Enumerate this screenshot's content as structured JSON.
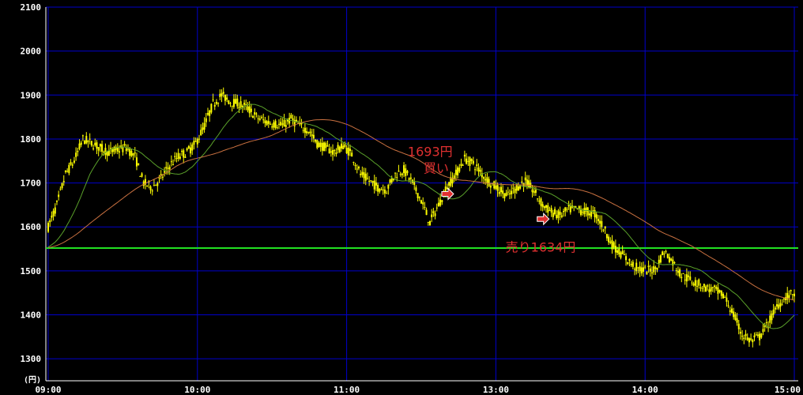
{
  "chart_data": {
    "type": "candlestick",
    "y_unit_label": "(円)",
    "ylim": [
      1250,
      2100
    ],
    "y_ticks": [
      "2100",
      "2000",
      "1900",
      "1800",
      "1700",
      "1600",
      "1500",
      "1400",
      "1300"
    ],
    "y_tick_values": [
      2100,
      2000,
      1900,
      1800,
      1700,
      1600,
      1500,
      1400,
      1300
    ],
    "x_ticks": [
      "09:00",
      "10:00",
      "11:00",
      "13:00",
      "14:00",
      "15:00"
    ],
    "reference_line": {
      "value": 1552,
      "color": "#22e022"
    },
    "colors": {
      "candle": "#ffff00",
      "grid": "#0000cc",
      "ma_short": "#5aa02a",
      "ma_long": "#c87040",
      "annotation": "#e03030"
    },
    "price_path": [
      [
        0,
        1600
      ],
      [
        1,
        1650
      ],
      [
        2,
        1720
      ],
      [
        3,
        1750
      ],
      [
        4,
        1800
      ],
      [
        5,
        1790
      ],
      [
        6,
        1780
      ],
      [
        7,
        1770
      ],
      [
        8,
        1775
      ],
      [
        9,
        1780
      ],
      [
        10,
        1760
      ],
      [
        11,
        1700
      ],
      [
        12,
        1690
      ],
      [
        13,
        1710
      ],
      [
        14,
        1740
      ],
      [
        15,
        1760
      ],
      [
        16,
        1770
      ],
      [
        17,
        1790
      ],
      [
        18,
        1830
      ],
      [
        19,
        1880
      ],
      [
        20,
        1900
      ],
      [
        21,
        1885
      ],
      [
        22,
        1880
      ],
      [
        23,
        1870
      ],
      [
        24,
        1850
      ],
      [
        25,
        1840
      ],
      [
        26,
        1835
      ],
      [
        27,
        1830
      ],
      [
        28,
        1845
      ],
      [
        29,
        1830
      ],
      [
        30,
        1820
      ],
      [
        31,
        1790
      ],
      [
        32,
        1780
      ],
      [
        33,
        1770
      ],
      [
        34,
        1785
      ],
      [
        35,
        1765
      ],
      [
        36,
        1720
      ],
      [
        37,
        1705
      ],
      [
        38,
        1690
      ],
      [
        39,
        1685
      ],
      [
        40,
        1720
      ],
      [
        41,
        1730
      ],
      [
        42,
        1700
      ],
      [
        43,
        1660
      ],
      [
        44,
        1610
      ],
      [
        45,
        1650
      ],
      [
        46,
        1693
      ],
      [
        47,
        1720
      ],
      [
        48,
        1755
      ],
      [
        49,
        1745
      ],
      [
        50,
        1720
      ],
      [
        51,
        1700
      ],
      [
        52,
        1685
      ],
      [
        53,
        1670
      ],
      [
        54,
        1690
      ],
      [
        55,
        1705
      ],
      [
        56,
        1680
      ],
      [
        57,
        1650
      ],
      [
        58,
        1634
      ],
      [
        59,
        1625
      ],
      [
        60,
        1640
      ],
      [
        61,
        1640
      ],
      [
        62,
        1635
      ],
      [
        63,
        1630
      ],
      [
        64,
        1600
      ],
      [
        65,
        1560
      ],
      [
        66,
        1540
      ],
      [
        67,
        1520
      ],
      [
        68,
        1505
      ],
      [
        69,
        1500
      ],
      [
        70,
        1505
      ],
      [
        71,
        1545
      ],
      [
        72,
        1520
      ],
      [
        73,
        1490
      ],
      [
        74,
        1480
      ],
      [
        75,
        1470
      ],
      [
        76,
        1460
      ],
      [
        77,
        1455
      ],
      [
        78,
        1440
      ],
      [
        79,
        1400
      ],
      [
        80,
        1355
      ],
      [
        81,
        1340
      ],
      [
        82,
        1350
      ],
      [
        83,
        1380
      ],
      [
        84,
        1420
      ],
      [
        85,
        1440
      ],
      [
        86,
        1450
      ]
    ],
    "annotations": [
      {
        "text": "1693円",
        "at": [
          46,
          1693
        ],
        "label_pos": "above"
      },
      {
        "text": "買い",
        "at": [
          46,
          1693
        ],
        "label_pos": "above"
      },
      {
        "text": "売り1634円",
        "at": [
          58,
          1634
        ],
        "label_pos": "below"
      }
    ],
    "buy_arrow_at": [
      46,
      1675
    ],
    "sell_arrow_at": [
      57,
      1618
    ]
  }
}
